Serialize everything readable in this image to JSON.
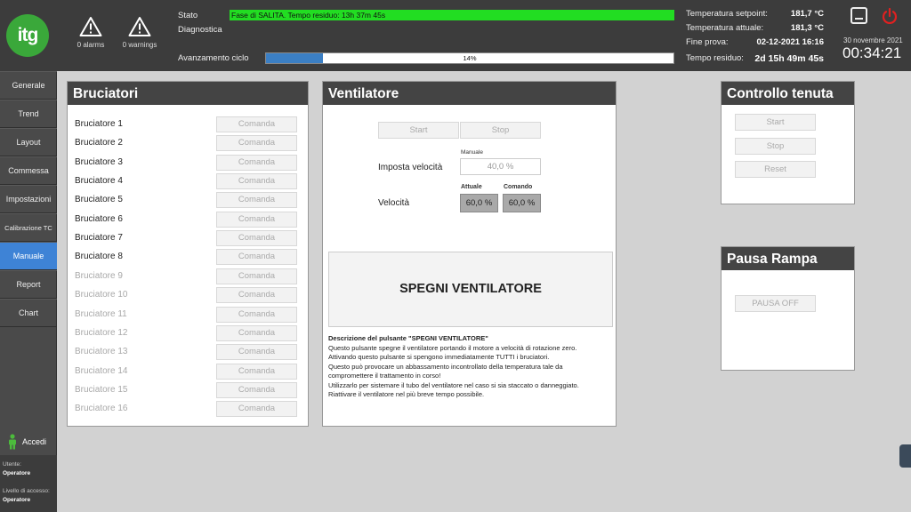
{
  "header": {
    "logo_text": "itg",
    "alarms": "0 alarms",
    "warnings": "0 warnings",
    "stato_label": "Stato",
    "stato_value": "Fase di SALITA. Tempo residuo: 13h 37m 45s",
    "diagnostica_label": "Diagnostica",
    "avanzamento_label": "Avanzamento ciclo",
    "avanzamento_percent": 14,
    "avanzamento_text": "14%",
    "info": [
      {
        "label": "Temperatura setpoint:",
        "value": "181,7 °C"
      },
      {
        "label": "Temperatura attuale:",
        "value": "181,3 °C"
      },
      {
        "label": "Fine prova:",
        "value": "02-12-2021 16:16"
      },
      {
        "label": "Tempo residuo:",
        "value": "2d 15h 49m 45s"
      }
    ],
    "date": "30 novembre 2021",
    "clock": "00:34:21",
    "colors": {
      "stato_ok": "#22dd22",
      "progress": "#3b7fc4",
      "power": "#e02020",
      "logo": "#3aa83a"
    }
  },
  "sidebar": {
    "items": [
      {
        "label": "Generale",
        "active": false
      },
      {
        "label": "Trend",
        "active": false
      },
      {
        "label": "Layout",
        "active": false
      },
      {
        "label": "Commessa",
        "active": false
      },
      {
        "label": "Impostazioni",
        "active": false
      },
      {
        "label": "Calibrazione TC",
        "active": false
      },
      {
        "label": "Manuale",
        "active": true
      },
      {
        "label": "Report",
        "active": false
      },
      {
        "label": "Chart",
        "active": false
      }
    ],
    "accedi": "Accedi",
    "utente_label": "Utente:",
    "utente_value": "Operatore",
    "livello_label": "Livello di accesso:",
    "livello_value": "Operatore"
  },
  "bruciatori": {
    "title": "Bruciatori",
    "button_label": "Comanda",
    "rows": [
      {
        "name": "Bruciatore 1",
        "enabled": true
      },
      {
        "name": "Bruciatore 2",
        "enabled": true
      },
      {
        "name": "Bruciatore 3",
        "enabled": true
      },
      {
        "name": "Bruciatore 4",
        "enabled": true
      },
      {
        "name": "Bruciatore 5",
        "enabled": true
      },
      {
        "name": "Bruciatore 6",
        "enabled": true
      },
      {
        "name": "Bruciatore 7",
        "enabled": true
      },
      {
        "name": "Bruciatore 8",
        "enabled": true
      },
      {
        "name": "Bruciatore 9",
        "enabled": false
      },
      {
        "name": "Bruciatore 10",
        "enabled": false
      },
      {
        "name": "Bruciatore 11",
        "enabled": false
      },
      {
        "name": "Bruciatore 12",
        "enabled": false
      },
      {
        "name": "Bruciatore 13",
        "enabled": false
      },
      {
        "name": "Bruciatore 14",
        "enabled": false
      },
      {
        "name": "Bruciatore 15",
        "enabled": false
      },
      {
        "name": "Bruciatore 16",
        "enabled": false
      }
    ]
  },
  "ventilatore": {
    "title": "Ventilatore",
    "start": "Start",
    "stop": "Stop",
    "manuale_label": "Manuale",
    "imposta_label": "Imposta velocità",
    "imposta_value": "40,0 %",
    "velocita_label": "Velocità",
    "attuale_label": "Attuale",
    "comando_label": "Comando",
    "attuale_value": "60,0 %",
    "comando_value": "60,0 %",
    "spegni_label": "SPEGNI VENTILATORE",
    "desc_title": "Descrizione del pulsante \"SPEGNI VENTILATORE\"",
    "desc_lines": [
      "Questo pulsante spegne il ventilatore portando il motore a velocità di rotazione zero.",
      "Attivando questo pulsante si spengono immediatamente TUTTI i bruciatori.",
      "Questo può provocare un abbassamento incontrollato della temperatura tale da",
      "compromettere il trattamento in corso!",
      "Utilizzarlo per sistemare il tubo del ventilatore nel caso si sia staccato o danneggiato.",
      "Riattivare il ventilatore nel più breve tempo possibile."
    ]
  },
  "controllo_tenuta": {
    "title": "Controllo tenuta",
    "start": "Start",
    "stop": "Stop",
    "reset": "Reset"
  },
  "pausa_rampa": {
    "title": "Pausa Rampa",
    "button": "PAUSA OFF"
  }
}
